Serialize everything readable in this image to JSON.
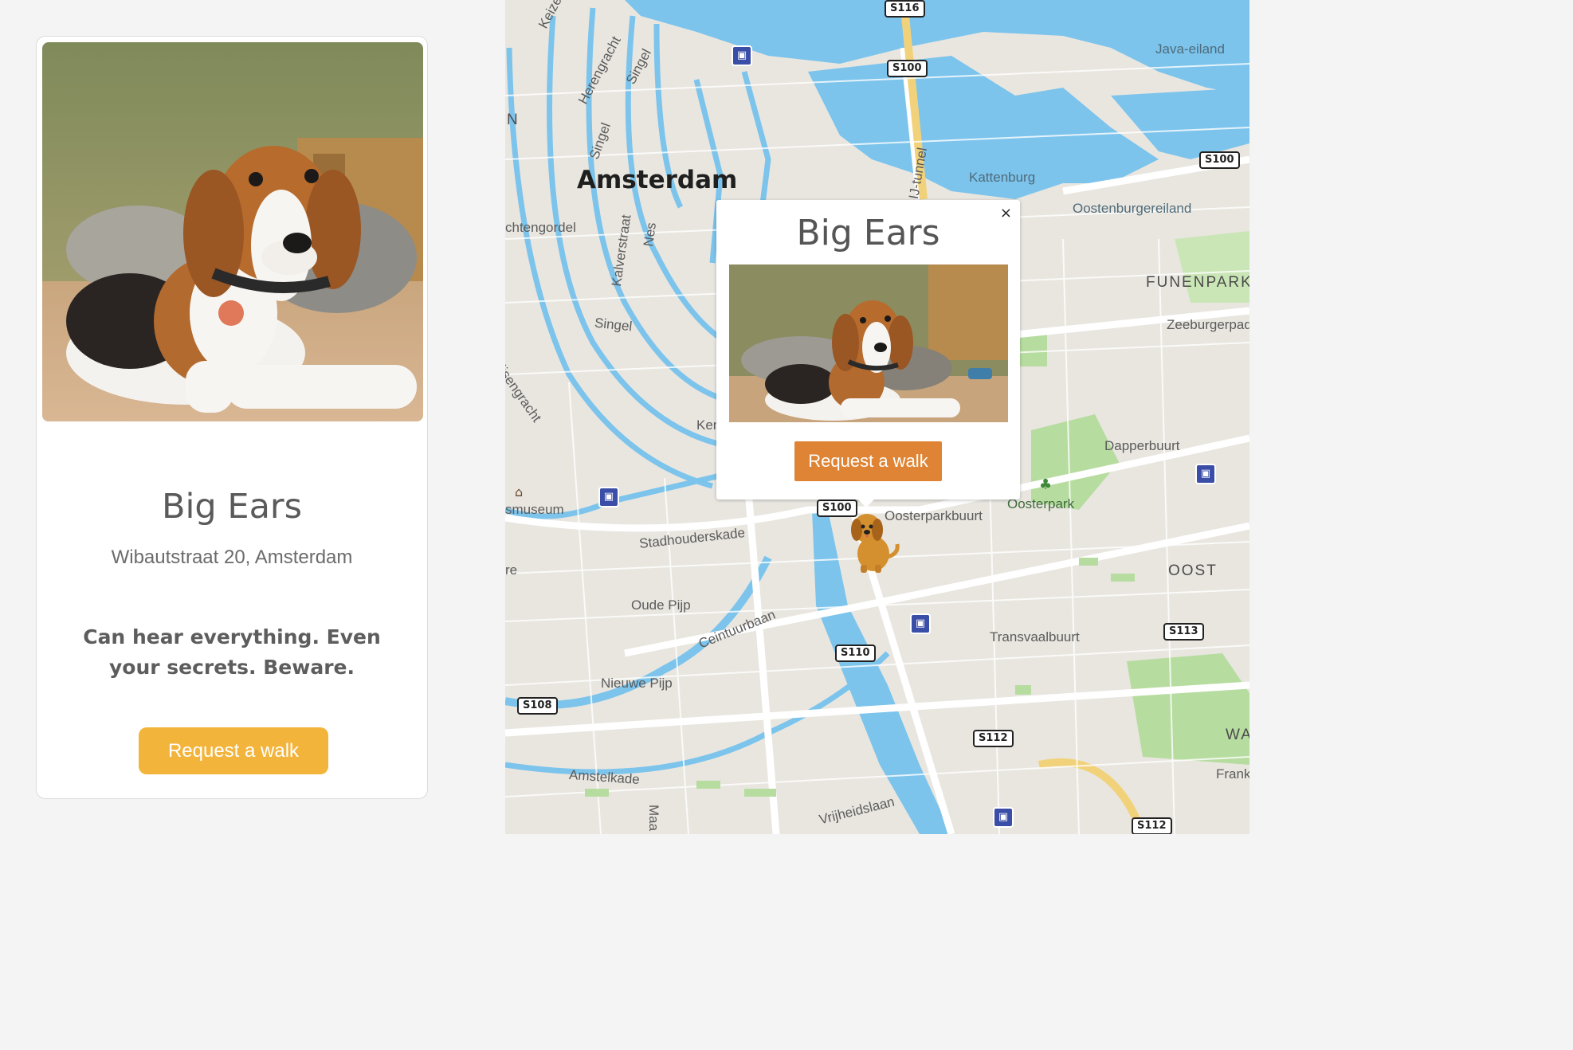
{
  "card": {
    "name": "Big Ears",
    "address": "Wibautstraat 20, Amsterdam",
    "description": "Can hear everything. Even your secrets. Beware.",
    "button_label": "Request a walk"
  },
  "popup": {
    "title": "Big Ears",
    "close_label": "×",
    "button_label": "Request a walk"
  },
  "map": {
    "city_label": "Amsterdam",
    "street_labels": [
      "Keizersgracht",
      "Herengracht",
      "Singel",
      "Singel",
      "Singel",
      "IJ-tunnel",
      "Kalverstraat",
      "Nes",
      "chtengordel",
      "ijsengracht",
      "Stadhouderskade",
      "Ceintuurbaan",
      "Amstelkade",
      "Vrijheidslaan",
      "Zeeburgerpad",
      "Ken",
      "Maa"
    ],
    "place_labels": [
      "Java-eiland",
      "Kattenburg",
      "Oostenburgereiland",
      "Dapperbuurt",
      "Oosterpark",
      "Oosterparkbuurt",
      "Transvaalbuurt",
      "Oude Pijp",
      "Nieuwe Pijp",
      "smuseum",
      "re",
      "Frank"
    ],
    "area_labels": [
      "FUNENPARK",
      "OOST",
      "WA",
      "N"
    ],
    "road_shields": [
      "S116",
      "S100",
      "S100",
      "S100",
      "S110",
      "S108",
      "S112",
      "S113",
      "S112"
    ],
    "colors": {
      "water": "#7cc4ec",
      "land": "#e9e6e0",
      "park": "#b7dca0",
      "card_button": "#f3b43b",
      "popup_button": "#de8434"
    }
  }
}
